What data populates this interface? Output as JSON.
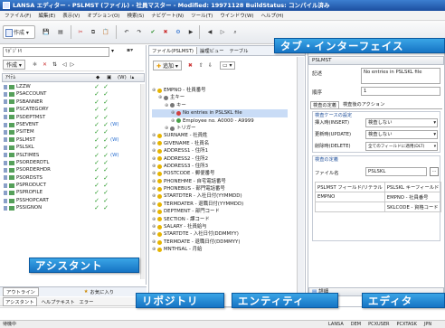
{
  "window": {
    "title": "LANSA エディター - PSLMST (ファイル) - 社員マスター - Modified: 19971128 BuildStatus: コンパイル済み"
  },
  "menu": [
    "ファイル(F)",
    "編集(E)",
    "表示(V)",
    "オプション(O)",
    "検索(S)",
    "ナビゲート(N)",
    "ツール(T)",
    "ウインドウ(W)",
    "ヘルプ(H)"
  ],
  "toolbar": {
    "new_label": "作成"
  },
  "left": {
    "search_value": "ﾘﾎﾟｼﾞﾄﾘ",
    "new_label": "作成",
    "col_header": "ｱｲﾃﾑ",
    "items": [
      {
        "name": "LZZW",
        "c1": "✓",
        "c2": "✓",
        "badge": ""
      },
      {
        "name": "PSACCOUNT",
        "c1": "✓",
        "c2": "✓",
        "badge": ""
      },
      {
        "name": "PSBANNER",
        "c1": "✓",
        "c2": "✓",
        "badge": ""
      },
      {
        "name": "PSCATEGORY",
        "c1": "✓",
        "c2": "✓",
        "badge": ""
      },
      {
        "name": "PSDEPTMST",
        "c1": "✓",
        "c2": "✓",
        "badge": ""
      },
      {
        "name": "PSEVENT",
        "c1": "✓",
        "c2": "✓",
        "badge": "(W)"
      },
      {
        "name": "PSITEM",
        "c1": "✓",
        "c2": "✓",
        "badge": ""
      },
      {
        "name": "PSLMST",
        "c1": "✓",
        "c2": "✓",
        "badge": "(W)"
      },
      {
        "name": "PSLSKL",
        "c1": "✓",
        "c2": "✓",
        "badge": ""
      },
      {
        "name": "PSLTIMES",
        "c1": "✓",
        "c2": "✓",
        "badge": "(W)"
      },
      {
        "name": "PSORDERDTL",
        "c1": "✓",
        "c2": "✓",
        "badge": ""
      },
      {
        "name": "PSORDERHDR",
        "c1": "✓",
        "c2": "✓",
        "badge": ""
      },
      {
        "name": "PSORDSTS",
        "c1": "✓",
        "c2": "✓",
        "badge": ""
      },
      {
        "name": "PSPRODUCT",
        "c1": "✓",
        "c2": "✓",
        "badge": ""
      },
      {
        "name": "PSPROFILE",
        "c1": "✓",
        "c2": "✓",
        "badge": ""
      },
      {
        "name": "PSSHOPCART",
        "c1": "✓",
        "c2": "✓",
        "badge": ""
      },
      {
        "name": "PSSIGNON",
        "c1": "✓",
        "c2": "✓",
        "badge": ""
      }
    ],
    "tabs": [
      "アウトライン",
      "",
      "お気に入り"
    ],
    "bottom_tabs": [
      "アシスタント",
      "ヘルプテキスト",
      "エラー"
    ]
  },
  "middle": {
    "tabs": [
      "ファイル(PSLMST)",
      "論理ビュー",
      "テーブル"
    ],
    "add_label": "追加",
    "tree": [
      {
        "t": "EMPNO - 社員番号",
        "lvl": 1,
        "color": "#e6b400"
      },
      {
        "t": "主キー",
        "lvl": 2,
        "color": "#777"
      },
      {
        "t": "キー",
        "lvl": 3,
        "color": "#777"
      },
      {
        "t": "No entries in PSLSKL file",
        "lvl": 4,
        "color": "#d04040",
        "sel": true
      },
      {
        "t": "Employee no. A0000 - A9999",
        "lvl": 4,
        "color": "#4aa04a"
      },
      {
        "t": "トリガー",
        "lvl": 3,
        "color": "#777"
      },
      {
        "t": "SURNAME - 社員姓",
        "lvl": 1,
        "color": "#e6b400"
      },
      {
        "t": "GIVENAME - 社員名",
        "lvl": 1,
        "color": "#e6b400"
      },
      {
        "t": "ADDRESS1 - 住所1",
        "lvl": 1,
        "color": "#e6b400"
      },
      {
        "t": "ADDRESS2 - 住所2",
        "lvl": 1,
        "color": "#e6b400"
      },
      {
        "t": "ADDRESS3 - 住所3",
        "lvl": 1,
        "color": "#e6b400"
      },
      {
        "t": "POSTCODE - 郵便番号",
        "lvl": 1,
        "color": "#e6b400"
      },
      {
        "t": "PHONEHME - 自宅電話番号",
        "lvl": 1,
        "color": "#e6b400"
      },
      {
        "t": "PHONEBUS - 部門電話番号",
        "lvl": 1,
        "color": "#e6b400"
      },
      {
        "t": "STARTDTER - 入社日付(YYMMDD)",
        "lvl": 1,
        "color": "#e6b400"
      },
      {
        "t": "TERMDATER - 退職日付(YYMMDD)",
        "lvl": 1,
        "color": "#e6b400"
      },
      {
        "t": "DEPTMENT - 部門コード",
        "lvl": 1,
        "color": "#e6b400"
      },
      {
        "t": "SECTION - 課コード",
        "lvl": 1,
        "color": "#e6b400"
      },
      {
        "t": "SALARY - 社員給与",
        "lvl": 1,
        "color": "#e6b400"
      },
      {
        "t": "STARTDTE - 入社日付(DDMMYY)",
        "lvl": 1,
        "color": "#e6b400"
      },
      {
        "t": "TERMDATE - 退職日付(DDMMYY)",
        "lvl": 1,
        "color": "#e6b400"
      },
      {
        "t": "MNTHSAL - 月給",
        "lvl": 1,
        "color": "#e6b400"
      }
    ]
  },
  "right": {
    "tab": "PSLMST",
    "memo_label": "記述",
    "memo_value": "No entries in PSLSKL file",
    "seq_label": "順序",
    "seq_value": "1",
    "subtabs": [
      "検査の定義",
      "検査後のアクション"
    ],
    "group1": "検査ケースの設定",
    "rows": [
      {
        "label": "挿入時(INSERT)",
        "value": "検査しない"
      },
      {
        "label": "更新時(UPDATE)",
        "value": "検査しない"
      },
      {
        "label": "削除時(DELETE)",
        "value": "全てのフィールドに適用(DLT)"
      }
    ],
    "group2": "検査の定義",
    "file_label": "ファイル名",
    "file_value": "PSLSKL",
    "grid": [
      [
        "PSLMST フィールド/リテラル",
        "PSLSKL キーフィールド"
      ],
      [
        "EMPNO",
        "EMPNO - 社員番号"
      ],
      [
        "",
        "SKLCODE - 資格コード"
      ]
    ],
    "detail_label": "詳細"
  },
  "callouts": {
    "tab": "タブ・インターフェイス",
    "assistant": "アシスタント",
    "repository": "リポジトリ",
    "entity": "エンティティ",
    "editor": "エディタ"
  },
  "status": {
    "left": "待機中",
    "right": [
      "LANSA",
      "DEM",
      "PCXUSER",
      "PCXTASK",
      "JPN"
    ]
  }
}
